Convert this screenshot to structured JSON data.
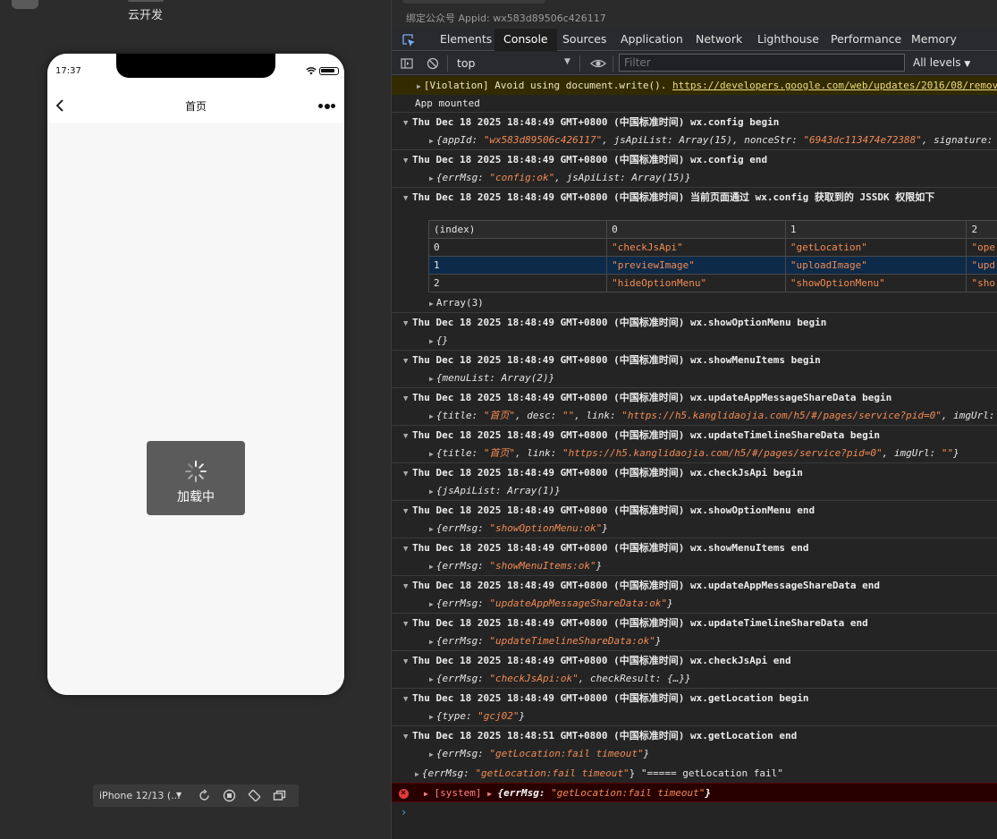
{
  "simulator": {
    "cloud_label": "云开发",
    "status_time": "17:37",
    "nav_title": "首页",
    "loading_text": "加载中",
    "device": "iPhone 12/13 (..."
  },
  "devtools": {
    "appid_text": "绑定公众号 Appid: wx583d89506c426117",
    "tabs": [
      "Elements",
      "Console",
      "Sources",
      "Application",
      "Network",
      "Lighthouse",
      "Performance",
      "Memory"
    ],
    "active_tab": "Console",
    "context": "top",
    "filter_placeholder": "Filter",
    "levels": "All levels"
  },
  "console": {
    "violation_prefix": "[Violation] Avoid using document.write(). ",
    "violation_link": "https://developers.google.com/web/updates/2016/08/removi",
    "app_mounted": "App mounted",
    "ts": "Thu Dec 18 2025 18:48:49 GMT+0800 (中国标准时间)",
    "ts_end": "Thu Dec 18 2025 18:48:51 GMT+0800 (中国标准时间)",
    "groups": [
      {
        "title": "wx.config begin"
      },
      {
        "title": "wx.config end"
      },
      {
        "title": "当前页面通过 wx.config 获取到的 JSSDK 权限如下"
      },
      {
        "title": "wx.showOptionMenu begin"
      },
      {
        "title": "wx.showMenuItems begin"
      },
      {
        "title": "wx.updateAppMessageShareData begin"
      },
      {
        "title": "wx.updateTimelineShareData begin"
      },
      {
        "title": "wx.checkJsApi begin"
      },
      {
        "title": "wx.showOptionMenu end"
      },
      {
        "title": "wx.showMenuItems end"
      },
      {
        "title": "wx.updateAppMessageShareData end"
      },
      {
        "title": "wx.updateTimelineShareData end"
      },
      {
        "title": "wx.checkJsApi end"
      },
      {
        "title": "wx.getLocation begin"
      },
      {
        "title": "wx.getLocation end"
      }
    ],
    "table": {
      "headers": [
        "(index)",
        "0",
        "1",
        "2"
      ],
      "rows": [
        [
          "0",
          "\"checkJsApi\"",
          "\"getLocation\"",
          "\"ope"
        ],
        [
          "1",
          "\"previewImage\"",
          "\"uploadImage\"",
          "\"upd"
        ],
        [
          "2",
          "\"hideOptionMenu\"",
          "\"showOptionMenu\"",
          "\"sho"
        ]
      ],
      "array_label": "Array(3)"
    },
    "system_tag": "[system]",
    "errmsg_key": "{errMsg: ",
    "getloc_fail": "\"getLocation:fail timeout\"",
    "getloc_fail_suffix": "} \"===== getLocation fail\""
  }
}
